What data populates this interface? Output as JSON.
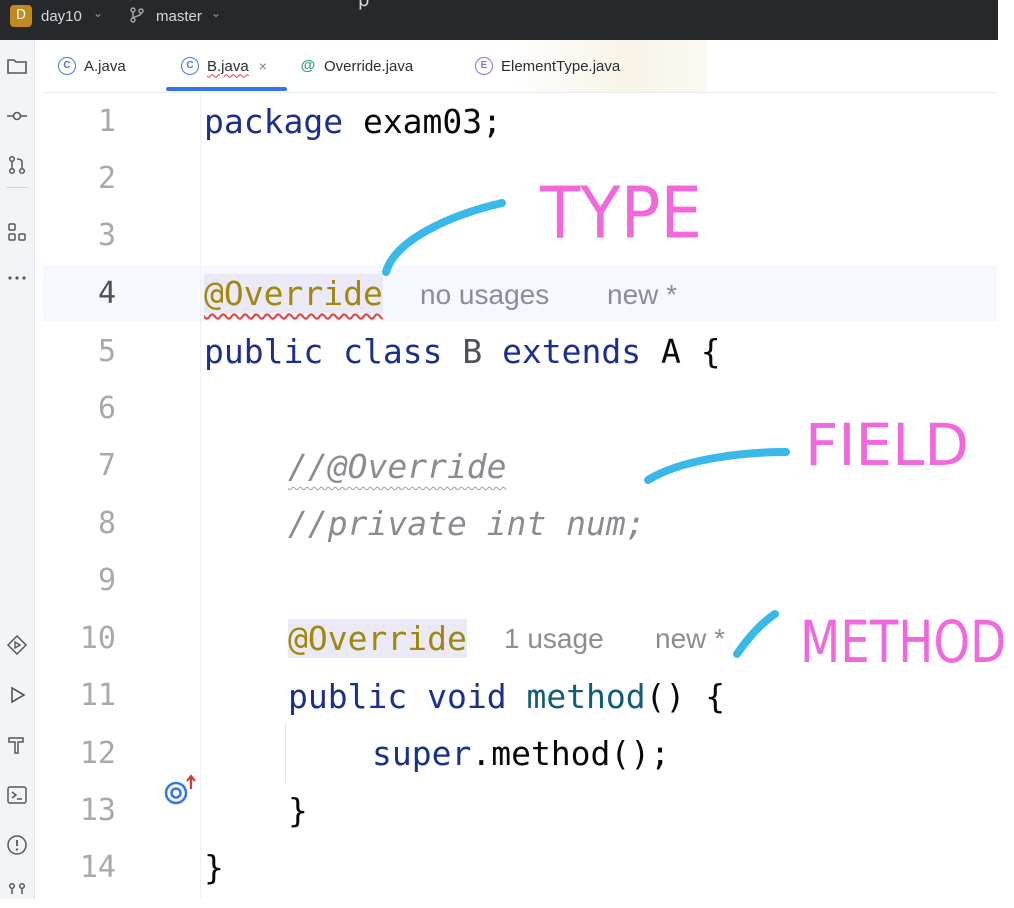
{
  "topbar": {
    "project_badge": "D",
    "project_name": "day10",
    "branch_name": "master",
    "fragment": "p"
  },
  "tabs": [
    {
      "label": "A.java",
      "icon": "class-icon",
      "icon_glyph": "C",
      "active": false
    },
    {
      "label": "B.java",
      "icon": "class-icon",
      "icon_glyph": "C",
      "active": true,
      "close": "×"
    },
    {
      "label": "Override.java",
      "icon": "annotation-icon",
      "icon_glyph": "@",
      "active": false
    },
    {
      "label": "ElementType.java",
      "icon": "enum-icon",
      "icon_glyph": "E",
      "active": false
    }
  ],
  "editor": {
    "current_line": 4,
    "lines": [
      {
        "n": "1",
        "text": "package exam03;"
      },
      {
        "n": "2",
        "text": ""
      },
      {
        "n": "3",
        "text": ""
      },
      {
        "n": "4",
        "text": "@Override",
        "hint_usages": "no usages",
        "hint_new": "new *"
      },
      {
        "n": "5",
        "text": "public class B extends A {"
      },
      {
        "n": "6",
        "text": ""
      },
      {
        "n": "7",
        "text": "    //@Override"
      },
      {
        "n": "8",
        "text": "    //private int num;"
      },
      {
        "n": "9",
        "text": ""
      },
      {
        "n": "10",
        "text": "    @Override",
        "hint_usages": "1 usage",
        "hint_new": "new *"
      },
      {
        "n": "11",
        "text": "    public void method() {"
      },
      {
        "n": "12",
        "text": "        super.method();"
      },
      {
        "n": "13",
        "text": "    }"
      },
      {
        "n": "14",
        "text": "}"
      }
    ],
    "tokens": {
      "l1_kw": "package",
      "l1_rest": " exam03;",
      "l4_ann": "@Override",
      "l5_kw1": "public",
      "l5_kw2": "class",
      "l5_name": "B",
      "l5_kw3": "extends",
      "l5_rest": "A {",
      "l7_cm": "//@Override",
      "l8_cm": "//private int num;",
      "l10_ann": "@Override",
      "l11_kw1": "public",
      "l11_kw2": "void",
      "l11_fn": "method",
      "l11_rest": "() {",
      "l12_kw": "super",
      "l12_rest": ".method();",
      "l13": "}",
      "l14": "}"
    }
  },
  "annotations": {
    "type_label": "TYPE",
    "field_label": "FIELD",
    "method_label": "METHOD",
    "stroke_color": "#39b9ea",
    "text_color": "#f168dd"
  }
}
